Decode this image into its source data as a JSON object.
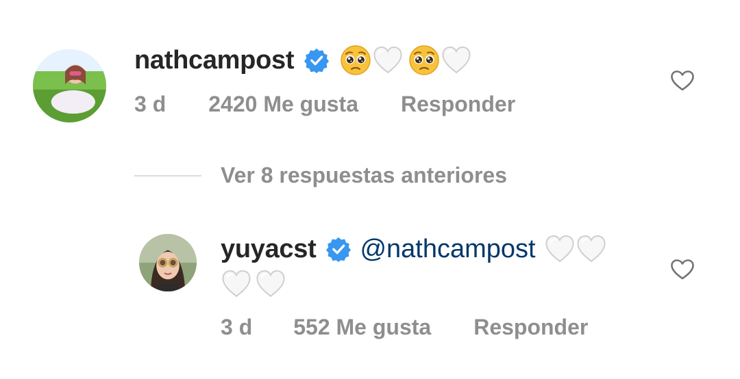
{
  "comment": {
    "username": "nathcampost",
    "verified": true,
    "content_emojis": [
      "pleading-face",
      "white-heart",
      "pleading-face",
      "white-heart"
    ],
    "time": "3 d",
    "likes": "2420 Me gusta",
    "reply_label": "Responder"
  },
  "view_replies": {
    "label": "Ver 8 respuestas anteriores"
  },
  "reply": {
    "username": "yuyacst",
    "verified": true,
    "mention": "@nathcampost",
    "content_emojis": [
      "white-heart",
      "white-heart",
      "white-heart",
      "white-heart"
    ],
    "time": "3 d",
    "likes": "552 Me gusta",
    "reply_label": "Responder"
  },
  "colors": {
    "username": "#262626",
    "meta": "#8e8e8e",
    "mention": "#00376b",
    "verified_badge": "#3897f0",
    "divider": "#dbdbdb"
  }
}
